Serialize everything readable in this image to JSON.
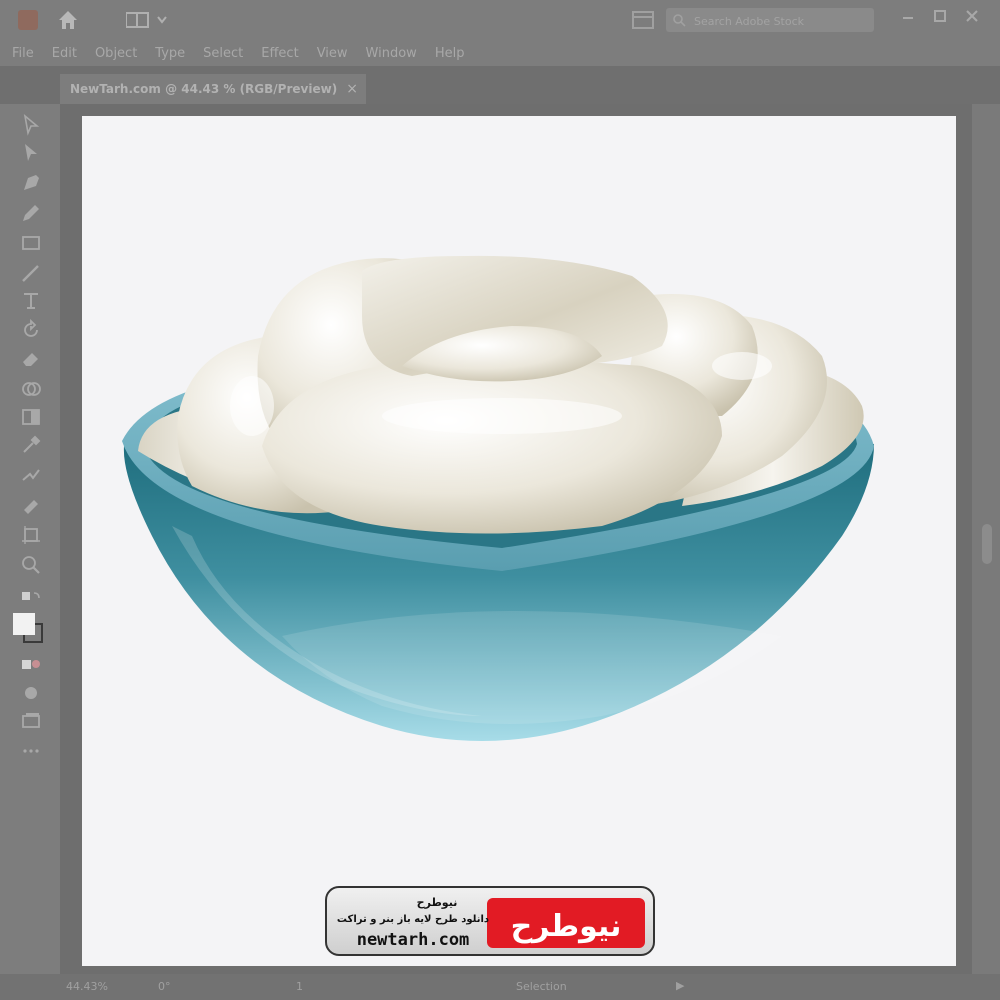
{
  "window": {
    "search_placeholder": "Search Adobe Stock"
  },
  "menu": [
    "File",
    "Edit",
    "Object",
    "Type",
    "Select",
    "Effect",
    "View",
    "Window",
    "Help"
  ],
  "document": {
    "tab_label": "NewTarh.com @ 44.43 % (RGB/Preview)",
    "close_symbol": "×"
  },
  "status": {
    "zoom": "44.43%",
    "rotation": "0°",
    "artboard": "1",
    "tool": "Selection",
    "arrow": "▶"
  },
  "watermark": {
    "brand_fa": "نیوطرح",
    "tagline_fa": "دانلود طرح لایه باز بنر و تراکت",
    "url": "newtarh.com"
  },
  "colors": {
    "chrome": "#7d7d7d",
    "artboard": "#f4f4f6",
    "bowl_teal": "#2f7f8f",
    "bowl_light": "#a7dce8",
    "cream": "#ece8dc",
    "brand_red": "#e21b24"
  },
  "icons": {
    "home": "home-icon",
    "search": "search-icon",
    "tools": [
      "selection-icon",
      "direct-selection-icon",
      "pen-icon",
      "pencil-icon",
      "rectangle-icon",
      "brush-icon",
      "type-icon",
      "rotate-icon",
      "eraser-icon",
      "shape-builder-icon",
      "gradient-icon",
      "eyedropper-icon",
      "blend-icon",
      "symbol-sprayer-icon",
      "artboard-icon",
      "zoom-icon"
    ]
  }
}
